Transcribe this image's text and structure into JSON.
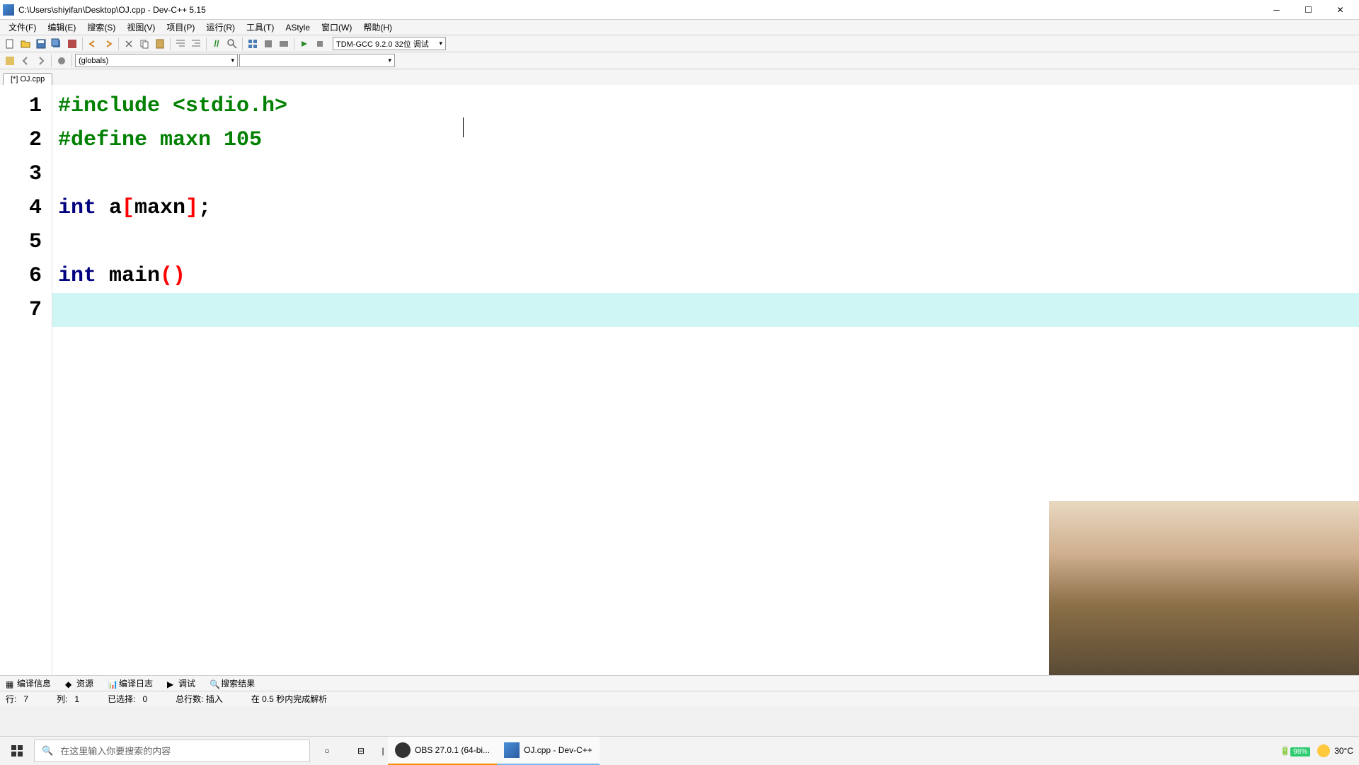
{
  "window": {
    "title": "C:\\Users\\shiyifan\\Desktop\\OJ.cpp - Dev-C++ 5.15"
  },
  "menu": {
    "file": "文件(F)",
    "edit": "编辑(E)",
    "search": "搜索(S)",
    "view": "视图(V)",
    "project": "项目(P)",
    "run": "运行(R)",
    "tools": "工具(T)",
    "astyle": "AStyle",
    "window": "窗口(W)",
    "help": "帮助(H)"
  },
  "compiler": {
    "selected": "TDM-GCC 9.2.0 32位 调试"
  },
  "scope_dropdown": {
    "selected": "(globals)"
  },
  "tab": {
    "name": "[*] OJ.cpp"
  },
  "code": {
    "lines": [
      {
        "num": "1",
        "tokens": [
          {
            "c": "preproc",
            "t": "#include <stdio.h>"
          }
        ]
      },
      {
        "num": "2",
        "tokens": [
          {
            "c": "preproc",
            "t": "#define maxn 105"
          }
        ]
      },
      {
        "num": "3",
        "tokens": []
      },
      {
        "num": "4",
        "tokens": [
          {
            "c": "type-kw",
            "t": "int"
          },
          {
            "c": "",
            "t": " a"
          },
          {
            "c": "bracket-red",
            "t": "["
          },
          {
            "c": "",
            "t": "maxn"
          },
          {
            "c": "bracket-red",
            "t": "]"
          },
          {
            "c": "",
            "t": ";"
          }
        ]
      },
      {
        "num": "5",
        "tokens": []
      },
      {
        "num": "6",
        "tokens": [
          {
            "c": "type-kw",
            "t": "int"
          },
          {
            "c": "",
            "t": " main"
          },
          {
            "c": "paren-red",
            "t": "()"
          }
        ]
      },
      {
        "num": "7",
        "tokens": [],
        "highlight": true
      }
    ]
  },
  "bottom_tabs": {
    "compile_info": "编译信息",
    "resources": "资源",
    "compile_log": "编译日志",
    "debug": "调试",
    "search_results": "搜索结果"
  },
  "status": {
    "line_label": "行:",
    "line_value": "7",
    "col_label": "列:",
    "col_value": "1",
    "sel_label": "已选择:",
    "sel_value": "0",
    "total_label": "总行数:",
    "mode": "插入",
    "parse": "在 0.5 秒内完成解析"
  },
  "taskbar": {
    "search_placeholder": "在这里输入你要搜索的内容",
    "obs": "OBS 27.0.1 (64-bi...",
    "devcpp": "OJ.cpp - Dev-C++",
    "battery": "98%",
    "temp": "30°C"
  }
}
